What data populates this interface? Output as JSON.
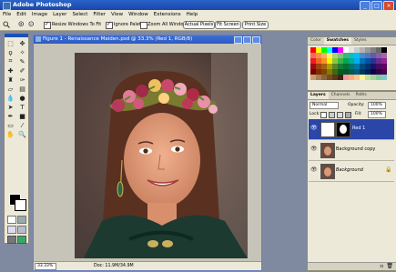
{
  "app": {
    "title": "Adobe Photoshop"
  },
  "menu": [
    "File",
    "Edit",
    "Image",
    "Layer",
    "Select",
    "Filter",
    "View",
    "Window",
    "Extensions",
    "Help"
  ],
  "options": {
    "resize_windows": "Resize Windows To Fit",
    "ignore_palettes": "Ignore Palettes",
    "zoom_all": "Zoom All Windows",
    "actual_pixels": "Actual Pixels",
    "fit_screen": "Fit Screen",
    "print_size": "Print Size"
  },
  "document": {
    "title": "Figure 1 - Renaissance Maiden.psd @ 33.3% (Red 1, RGB/8)",
    "zoom": "33.33%",
    "doc_info": "Doc: 11.9M/34.9M"
  },
  "swatches_palette": {
    "tabs": [
      "Color",
      "Swatches",
      "Styles"
    ],
    "active_tab": "Swatches",
    "colors": [
      "#ff0000",
      "#ffff00",
      "#00ff00",
      "#00ffff",
      "#0000ff",
      "#ff00ff",
      "#ffffff",
      "#e6e6e6",
      "#cccccc",
      "#b3b3b3",
      "#999999",
      "#808080",
      "#666666",
      "#000000",
      "#f26c4f",
      "#f68e55",
      "#fbaf5c",
      "#fff467",
      "#acd372",
      "#7cc576",
      "#3bb878",
      "#1abbb4",
      "#00bff3",
      "#438ccb",
      "#5574b9",
      "#605ca8",
      "#855fa8",
      "#a763a8",
      "#ed1c24",
      "#f26522",
      "#f7941d",
      "#fff200",
      "#8dc73f",
      "#39b54a",
      "#00a651",
      "#00a99d",
      "#00aeef",
      "#0072bc",
      "#0054a6",
      "#2e3192",
      "#662d91",
      "#92278f",
      "#9e0b0f",
      "#a0410d",
      "#a36209",
      "#aba000",
      "#598527",
      "#1a7b30",
      "#007236",
      "#00746b",
      "#0076a3",
      "#004b80",
      "#003471",
      "#1b1464",
      "#440e62",
      "#630460",
      "#790000",
      "#7b2e00",
      "#7d4900",
      "#827b00",
      "#406618",
      "#005e20",
      "#005826",
      "#005952",
      "#005b7f",
      "#003663",
      "#002157",
      "#0d004c",
      "#32004b",
      "#4b0049",
      "#c69c6d",
      "#a67c52",
      "#8c6239",
      "#754c24",
      "#603913",
      "#3c2415",
      "#f5989d",
      "#f9ad81",
      "#fdc68a",
      "#fff799",
      "#c4df9b",
      "#a3d39c",
      "#82ca9c",
      "#7accc8"
    ]
  },
  "layers_palette": {
    "tabs": [
      "Layers",
      "Channels",
      "Paths"
    ],
    "active_tab": "Layers",
    "blend_mode": "Normal",
    "opacity_label": "Opacity:",
    "opacity": "100%",
    "lock_label": "Lock:",
    "fill_label": "Fill:",
    "fill": "100%",
    "layers": [
      {
        "name": "Red 1",
        "selected": true
      },
      {
        "name": "Background copy",
        "selected": false
      },
      {
        "name": "Background",
        "selected": false
      }
    ]
  }
}
